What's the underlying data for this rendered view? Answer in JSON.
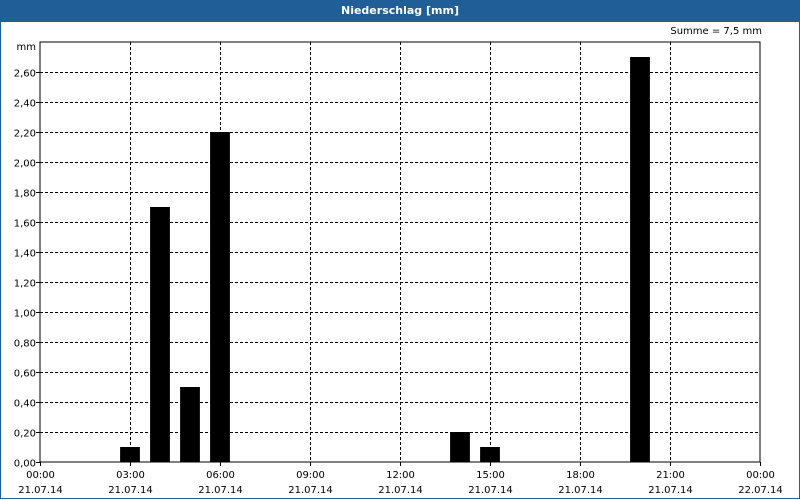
{
  "window": {
    "title": "Niederschlag [mm]"
  },
  "summary": {
    "text": "Summe = 7,5 mm"
  },
  "chart_data": {
    "type": "bar",
    "title": "Niederschlag [mm]",
    "ylabel": "mm",
    "xlabel": "",
    "x_axis": {
      "start": "2014-07-21 00:00",
      "end": "2014-07-22 00:00",
      "ticks": [
        {
          "time": "00:00",
          "date": "21.07.14"
        },
        {
          "time": "03:00",
          "date": "21.07.14"
        },
        {
          "time": "06:00",
          "date": "21.07.14"
        },
        {
          "time": "09:00",
          "date": "21.07.14"
        },
        {
          "time": "12:00",
          "date": "21.07.14"
        },
        {
          "time": "15:00",
          "date": "21.07.14"
        },
        {
          "time": "18:00",
          "date": "21.07.14"
        },
        {
          "time": "21:00",
          "date": "21.07.14"
        },
        {
          "time": "00:00",
          "date": "22.07.14"
        }
      ]
    },
    "ylim": [
      0,
      2.8
    ],
    "yticks": [
      "0,00",
      "0,20",
      "0,40",
      "0,60",
      "0,80",
      "1,00",
      "1,20",
      "1,40",
      "1,60",
      "1,80",
      "2,00",
      "2,20",
      "2,40",
      "2,60"
    ],
    "grid": true,
    "series": [
      {
        "color": "#000000",
        "points": [
          {
            "time": "03:00",
            "value": 0.1
          },
          {
            "time": "04:00",
            "value": 1.7
          },
          {
            "time": "05:00",
            "value": 0.5
          },
          {
            "time": "06:00",
            "value": 2.2
          },
          {
            "time": "14:00",
            "value": 0.2
          },
          {
            "time": "15:00",
            "value": 0.1
          },
          {
            "time": "20:00",
            "value": 2.7
          }
        ]
      }
    ]
  }
}
